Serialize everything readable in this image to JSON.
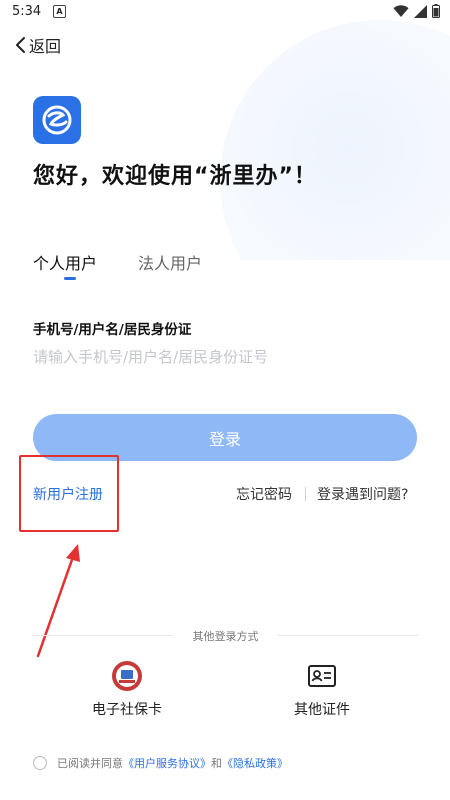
{
  "status_bar": {
    "time": "5:34",
    "notif_letter": "A"
  },
  "header": {
    "back_label": "返回"
  },
  "welcome": "您好，欢迎使用“浙里办”！",
  "tabs": [
    {
      "label": "个人用户",
      "active": true
    },
    {
      "label": "法人用户",
      "active": false
    }
  ],
  "form": {
    "account_label": "手机号/用户名/居民身份证",
    "account_placeholder": "请输入手机号/用户名/居民身份证号",
    "login_button": "登录"
  },
  "links": {
    "register": "新用户注册",
    "forgot_password": "忘记密码",
    "login_problem": "登录遇到问题?"
  },
  "other_login": {
    "title": "其他登录方式",
    "methods": [
      {
        "label": "电子社保卡",
        "icon": "social-security-card-icon"
      },
      {
        "label": "其他证件",
        "icon": "id-card-icon"
      }
    ]
  },
  "agreement": {
    "prefix": "已阅读并同意",
    "service_link": "《用户服务协议》",
    "and": "和",
    "privacy_link": "《隐私政策》"
  },
  "colors": {
    "accent": "#2a6fe0",
    "button": "#8fb8f6",
    "highlight": "#e53030"
  }
}
